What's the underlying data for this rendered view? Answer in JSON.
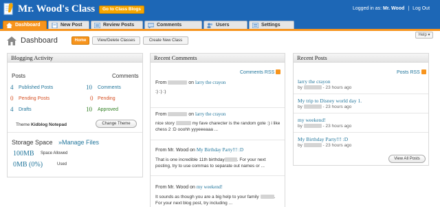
{
  "header": {
    "app_title": "Mr. Wood's Class",
    "goto_button": "Go to Class Blogs",
    "logged_in_prefix": "Logged in as:",
    "logged_in_user": "Mr. Wood",
    "separator": "|",
    "logout": "Log Out"
  },
  "tabs": [
    {
      "label": "Dashboard",
      "icon": "home-icon",
      "active": true
    },
    {
      "label": "New Post",
      "icon": "new-post-icon"
    },
    {
      "label": "Review Posts",
      "icon": "review-posts-icon"
    },
    {
      "label": "Comments",
      "icon": "comments-icon"
    },
    {
      "label": "Users",
      "icon": "users-icon"
    },
    {
      "label": "Settings",
      "icon": "settings-icon"
    }
  ],
  "subheader": {
    "title": "Dashboard",
    "help": "Help ▾",
    "buttons": [
      "Home",
      "View/Delete Classes",
      "Create New Class"
    ]
  },
  "blogging_activity": {
    "title": "Blogging Activity",
    "posts_header": "Posts",
    "comments_header": "Comments",
    "posts": [
      {
        "count": "4",
        "label": "Published Posts"
      },
      {
        "count": "0",
        "label": "Pending Posts"
      },
      {
        "count": "4",
        "label": "Drafts"
      }
    ],
    "comments": [
      {
        "count": "10",
        "label": "Comments"
      },
      {
        "count": "0",
        "label": "Pending"
      },
      {
        "count": "10",
        "label": "Approved"
      }
    ],
    "theme_prefix": "Theme",
    "theme_name": "Kidblog Notepad",
    "change_theme": "Change Theme",
    "storage_title": "Storage Space",
    "manage_files": "»Manage Files",
    "space_allowed_value": "100MB",
    "space_allowed_label": "Space Allowed",
    "used_value": "0MB (0%)",
    "used_label": "Used"
  },
  "recent_comments": {
    "title": "Recent Comments",
    "rss": "Comments RSS",
    "items": [
      {
        "from": "From",
        "on": "on",
        "post": "larry the crayon",
        "text1": ":) :) :)",
        "text2": ""
      },
      {
        "from": "From",
        "on": "on",
        "post": "larry the crayon",
        "text1a": "nice story",
        "text1b": "my fave charecter is the random gote :) i like",
        "text2": "chess 2 :D ooohh yyyeeeaaa ..."
      },
      {
        "from": "From Mr. Wood",
        "on": "on",
        "post": "My Birthday Party!!! :D",
        "text1a": "That is one incredible 11th birthday",
        "text1b": ". For your next",
        "text2": "posting, try to use commas to separate out names or ..."
      },
      {
        "from": "From Mr. Wood",
        "on": "on",
        "post": "my weekend!",
        "text1a": "It sounds as though you are a big help to your family",
        "text1b": ".",
        "text2": "For your next blog post, try including ..."
      }
    ]
  },
  "recent_posts": {
    "title": "Recent Posts",
    "rss": "Posts RSS",
    "items": [
      {
        "title": "larry the crayon",
        "by": "by",
        "time": "- 23 hours ago"
      },
      {
        "title": "My trip to Disney world day 1.",
        "by": "by",
        "time": "- 23 hours ago"
      },
      {
        "title": "my weekend!",
        "by": "by",
        "time": "- 23 hours ago"
      },
      {
        "title": "My Birthday Party!!! :D",
        "by": "by",
        "time": "- 23 hours ago"
      }
    ],
    "view_all": "View All Posts"
  },
  "colors": {
    "brand_blue": "#1d67b6",
    "accent_orange": "#f7941d",
    "link_blue": "#21759b",
    "pending_red": "#d54e21",
    "approved_green": "#2e7d1f"
  }
}
